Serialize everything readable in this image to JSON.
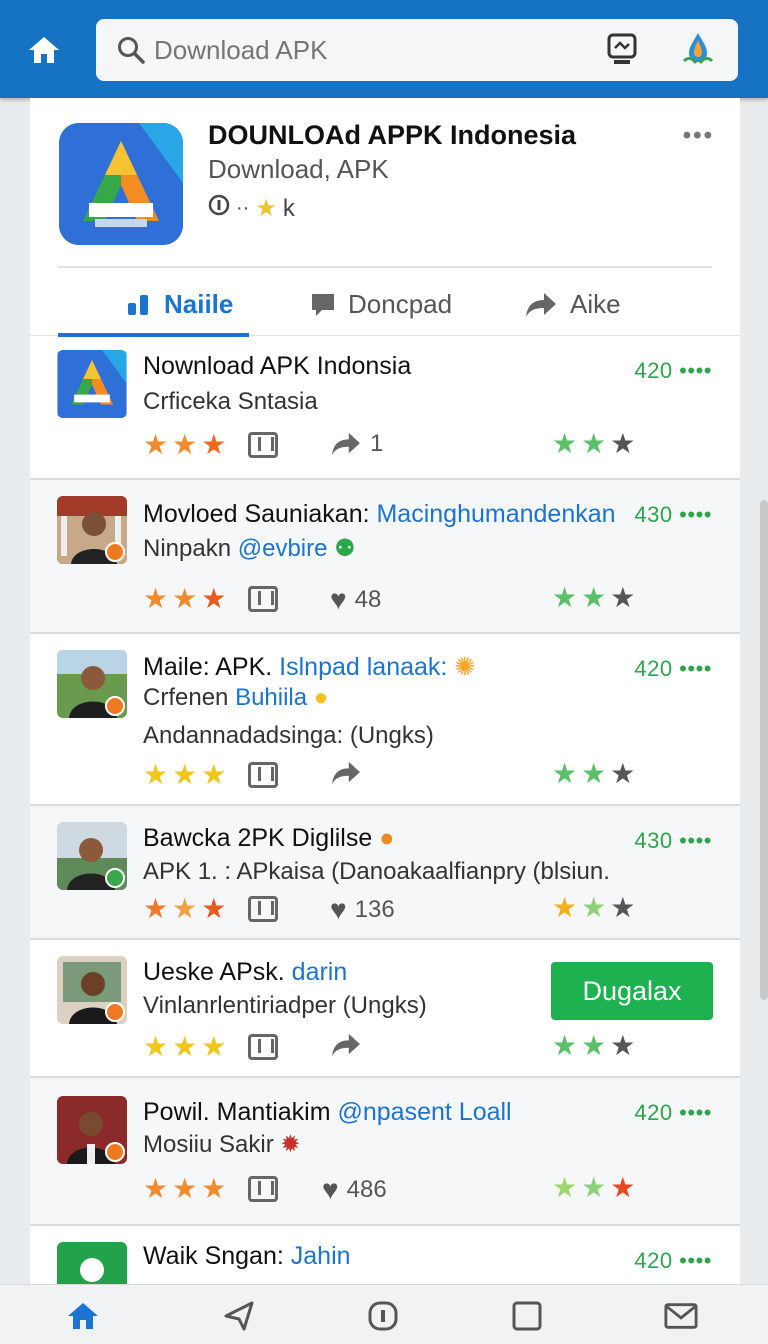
{
  "search": {
    "placeholder": "Download APK"
  },
  "app": {
    "title": "DOUNLOAd APPK Indonesia",
    "subtitle": "Download, APK",
    "meta": "k"
  },
  "tabs": [
    {
      "label": "Naiile"
    },
    {
      "label": "Doncpad"
    },
    {
      "label": "Aike"
    }
  ],
  "items": [
    {
      "title": "Nownload APK Indonsia",
      "title_hl": "",
      "sub": "Crficeka Sntasia",
      "sub_hl": "",
      "desc": "",
      "num": "420 ••••",
      "stat": "1",
      "stat_icon": "share"
    },
    {
      "title": "Movloed Sauniakan: ",
      "title_hl": "Macinghumandenkan",
      "sub": "Ninpakn ",
      "sub_hl": "@evbire",
      "desc": "",
      "num": "430 ••••",
      "stat": "48",
      "stat_icon": "heart"
    },
    {
      "title": "Maile: APK. ",
      "title_hl": "Islnpad lanaak:",
      "sub": "Crfenen ",
      "sub_hl": "Buhiila",
      "desc": "Andannadadsinga: (Ungks)",
      "num": "420 ••••",
      "stat": "",
      "stat_icon": "share"
    },
    {
      "title": "Bawcka 2PK Diglilse",
      "title_hl": "",
      "sub": "APK 1. : APkaisa (Danoakaalfianpry (blsiun.",
      "sub_hl": "",
      "desc": "",
      "num": "430 ••••",
      "stat": "136",
      "stat_icon": "heart"
    },
    {
      "title": "Ueske APsk. ",
      "title_hl": "darin",
      "sub": "Vinlanrlentiriadper (Ungks)",
      "sub_hl": "",
      "desc": "",
      "button": "Dugalax",
      "stat": "",
      "stat_icon": "share"
    },
    {
      "title": "Powil. Mantiakim ",
      "title_hl": "@npasent Loall",
      "sub": "Mosiiu ",
      "sub_hl": "Sakir",
      "desc": "",
      "num": "420 ••••",
      "stat": "486",
      "stat_icon": "heart"
    },
    {
      "title": "Waik Sngan: ",
      "title_hl": "Jahin",
      "sub": "",
      "sub_hl": "",
      "desc": "",
      "num": "420 ••••"
    }
  ],
  "colors": {
    "accent": "#1672c2",
    "tab_active": "#1b73d2",
    "positive": "#2ba64a",
    "button": "#1db24f"
  }
}
